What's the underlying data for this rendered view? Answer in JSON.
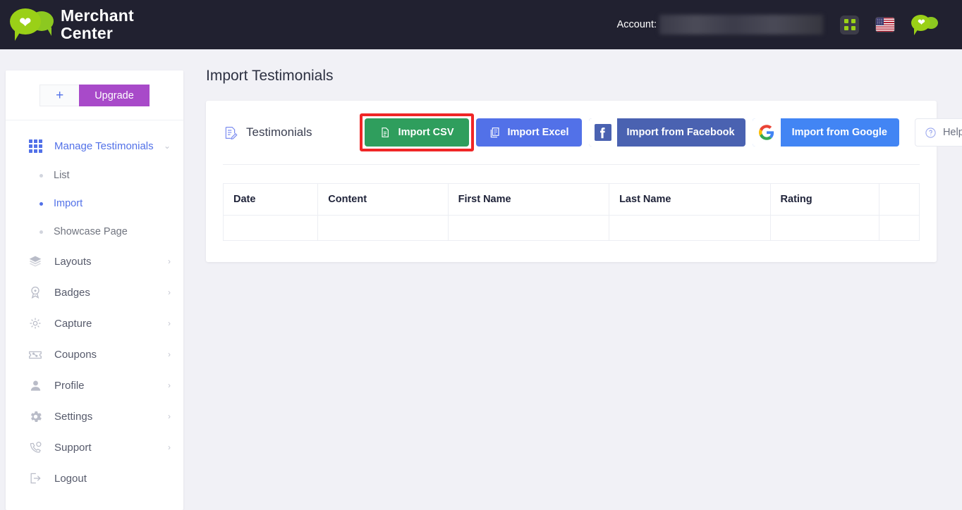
{
  "header": {
    "brand_line1": "Merchant",
    "brand_line2": "Center",
    "account_label": "Account:",
    "account_value": "",
    "apps_icon": "grid-apps-icon",
    "language_icon": "us-flag-icon",
    "logo_icon": "merchant-center-logo-icon"
  },
  "sidebar": {
    "add_label": "+",
    "upgrade_label": "Upgrade",
    "items": [
      {
        "label": "Manage Testimonials",
        "icon": "grid-icon",
        "expanded": true,
        "chevron": "⌄",
        "active": true
      },
      {
        "label": "Layouts",
        "icon": "layers-icon",
        "chevron": "›",
        "active": false
      },
      {
        "label": "Badges",
        "icon": "badge-icon",
        "chevron": "›",
        "active": false
      },
      {
        "label": "Capture",
        "icon": "capture-icon",
        "chevron": "›",
        "active": false
      },
      {
        "label": "Coupons",
        "icon": "coupon-icon",
        "chevron": "›",
        "active": false
      },
      {
        "label": "Profile",
        "icon": "user-icon",
        "chevron": "›",
        "active": false
      },
      {
        "label": "Settings",
        "icon": "gear-icon",
        "chevron": "›",
        "active": false
      },
      {
        "label": "Support",
        "icon": "headset-phone-icon",
        "chevron": "›",
        "active": false
      },
      {
        "label": "Logout",
        "icon": "logout-icon",
        "chevron": "",
        "active": false
      }
    ],
    "sub_items": [
      {
        "label": "List",
        "current": false
      },
      {
        "label": "Import",
        "current": true
      },
      {
        "label": "Showcase Page",
        "current": false
      }
    ]
  },
  "main": {
    "page_title": "Import Testimonials",
    "section_title": "Testimonials",
    "section_icon": "testimonial-doc-pencil-icon",
    "buttons": {
      "import_csv": "Import CSV",
      "import_excel": "Import Excel",
      "import_facebook": "Import from Facebook",
      "import_google": "Import from Google",
      "help": "Help",
      "help_chevron": "⌄"
    },
    "highlighted_button": "import-csv-button",
    "highlight_color": "#f02626",
    "table": {
      "columns": [
        "Date",
        "Content",
        "First Name",
        "Last Name",
        "Rating",
        ""
      ],
      "rows": []
    }
  },
  "colors": {
    "header_bg": "#212130",
    "page_bg": "#f1f1f6",
    "accent_blue": "#5271e8",
    "upgrade_purple": "#a84ac9",
    "green": "#2f9e5d",
    "facebook": "#4a62b1",
    "google": "#4285f4",
    "logo_green": "#9ad017"
  }
}
